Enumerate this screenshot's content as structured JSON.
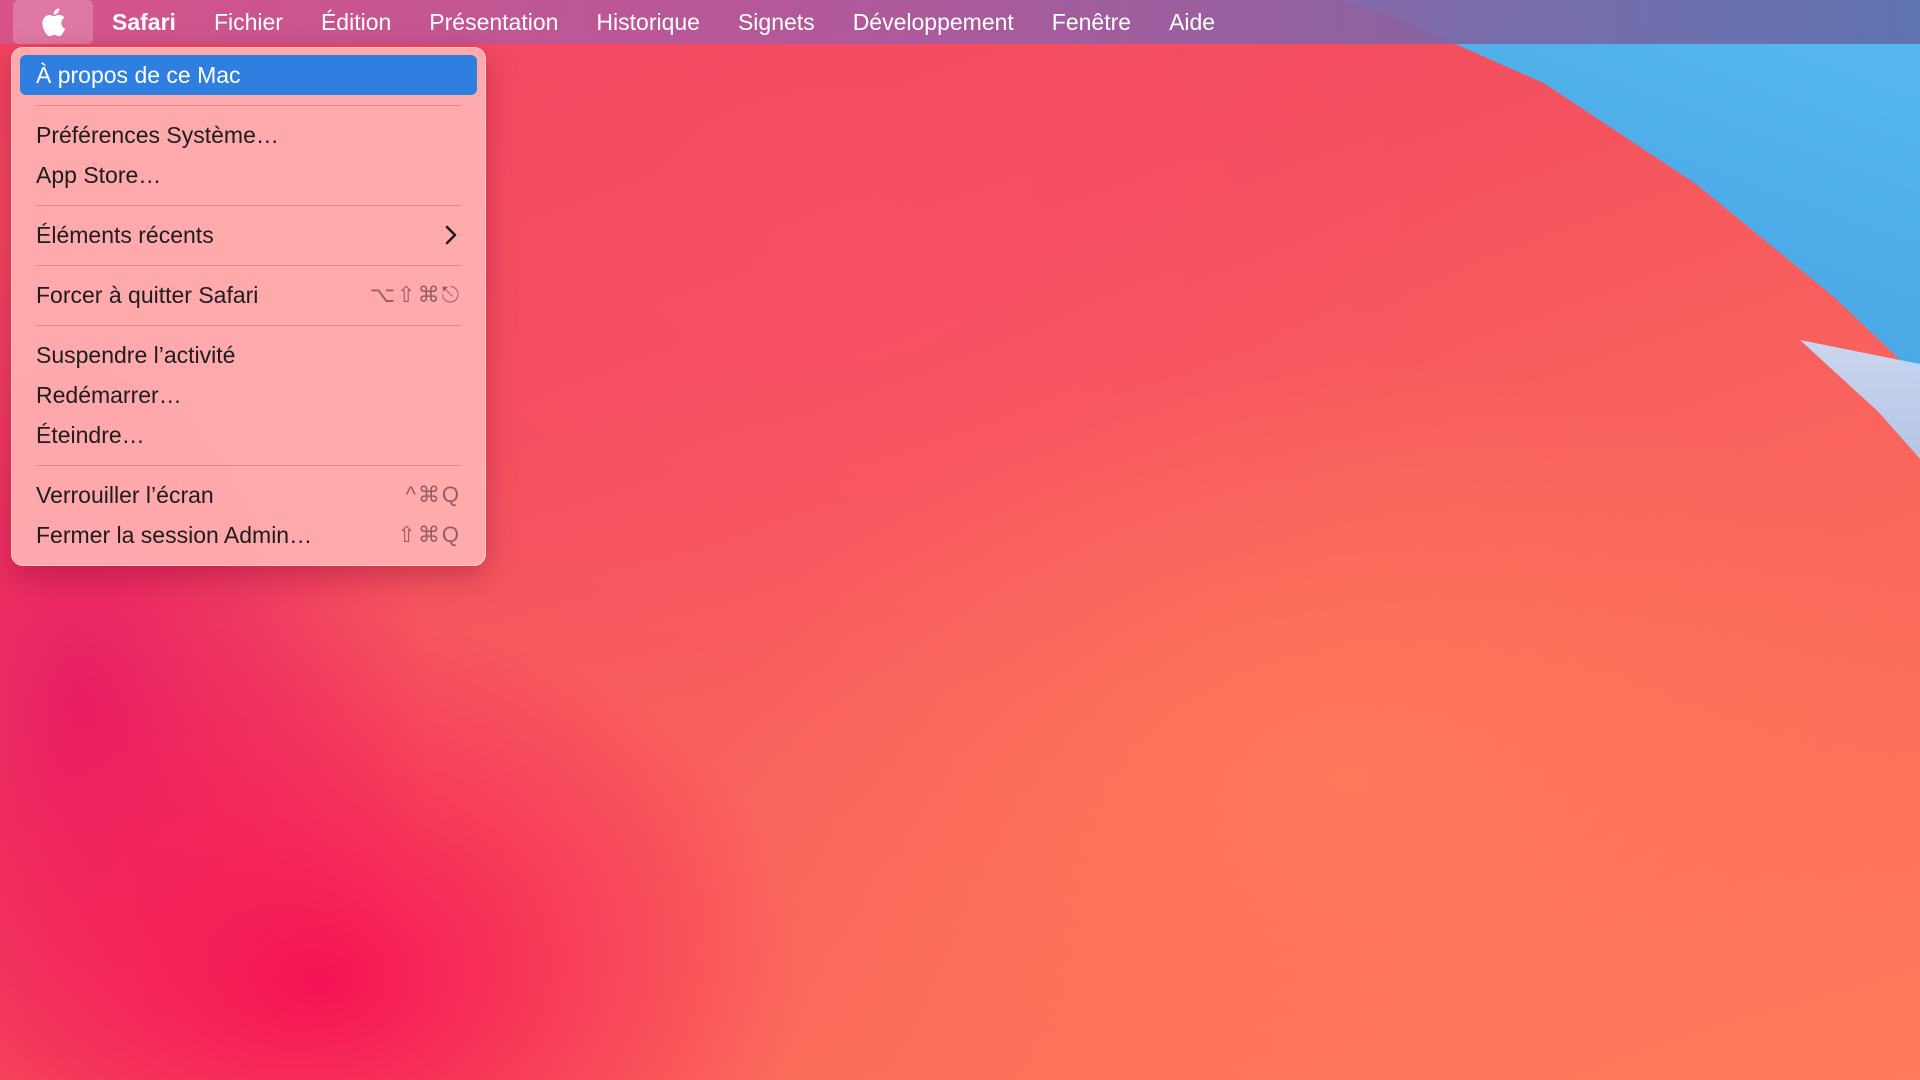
{
  "menubar": {
    "apple_icon": "apple-logo-icon",
    "app_name": "Safari",
    "menus": [
      "Fichier",
      "Édition",
      "Présentation",
      "Historique",
      "Signets",
      "Développement",
      "Fenêtre",
      "Aide"
    ]
  },
  "apple_menu": {
    "highlight_color": "#2f7fe0",
    "items": {
      "about": "À propos de ce Mac",
      "preferences": "Préférences Système…",
      "app_store": "App Store…",
      "recent_items": "Éléments récents",
      "force_quit": "Forcer à quitter Safari",
      "force_quit_shortcut": "⌥⇧⌘⎋",
      "sleep": "Suspendre l’activité",
      "restart": "Redémarrer…",
      "shutdown": "Éteindre…",
      "lock_screen": "Verrouiller l’écran",
      "lock_screen_shortcut": "^⌘Q",
      "logout": "Fermer la session Admin…",
      "logout_shortcut": "⇧⌘Q"
    }
  }
}
